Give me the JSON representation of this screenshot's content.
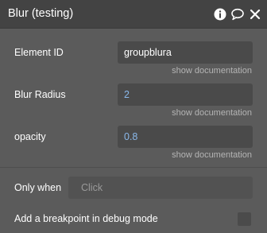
{
  "header": {
    "title": "Blur (testing)",
    "icons": [
      "info-icon",
      "comment-icon",
      "close-icon"
    ]
  },
  "properties": {
    "element_id": {
      "label": "Element ID",
      "value": "groupblura",
      "doc_link": "show documentation"
    },
    "blur_radius": {
      "label": "Blur Radius",
      "value": "2",
      "doc_link": "show documentation"
    },
    "opacity": {
      "label": "opacity",
      "value": "0.8",
      "doc_link": "show documentation"
    }
  },
  "conditions": {
    "only_when_label": "Only when",
    "only_when_placeholder": "Click"
  },
  "debug": {
    "breakpoint_label": "Add a breakpoint in debug mode",
    "checked": false
  },
  "colors": {
    "panel_bg": "#5b5b5b",
    "header_bg": "#434343",
    "field_bg": "#4a4a4a",
    "number_text": "#8ab8ea",
    "doc_link": "#b4b4b4"
  }
}
